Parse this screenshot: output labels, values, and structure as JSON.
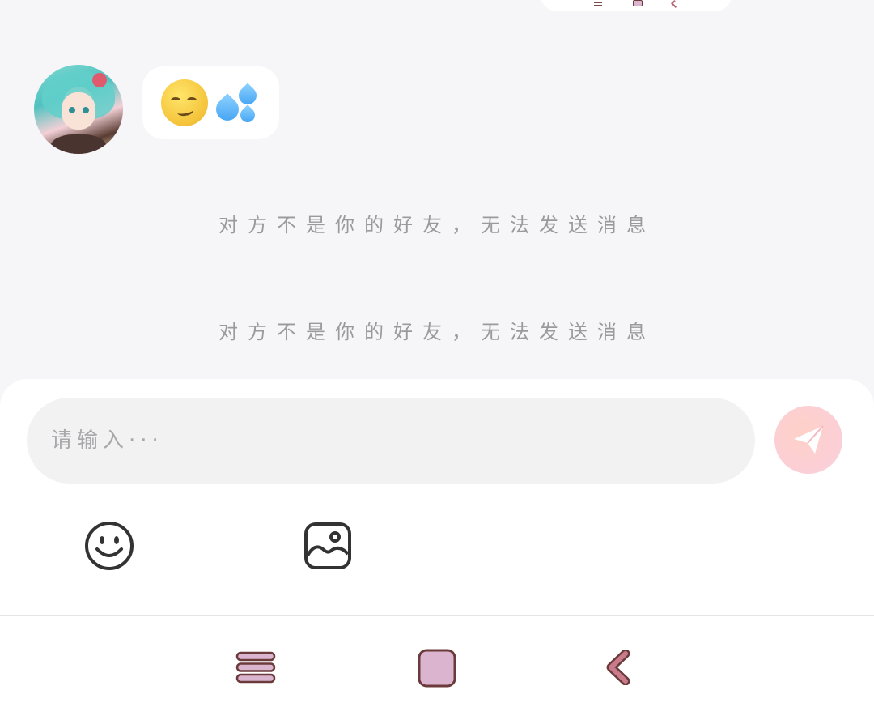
{
  "chat": {
    "system_messages": [
      "对方不是你的好友，无法发送消息",
      "对方不是你的好友，无法发送消息"
    ],
    "incoming_message": {
      "emojis": [
        "smirk-face-emoji",
        "sweat-droplets-emoji"
      ]
    }
  },
  "composer": {
    "placeholder": "请输入···",
    "send_icon": "paper-plane-icon",
    "tools": [
      "emoji-icon",
      "image-icon"
    ]
  },
  "nav": {
    "items": [
      "menu-icon",
      "home-icon",
      "back-icon"
    ]
  },
  "colors": {
    "background": "#f6f6f8",
    "bubble": "#ffffff",
    "send_button": "#fbcfd7",
    "system_text": "#9a9a9e",
    "nav_accent": "#dbb5cf",
    "nav_outline": "#6b3b3b"
  }
}
